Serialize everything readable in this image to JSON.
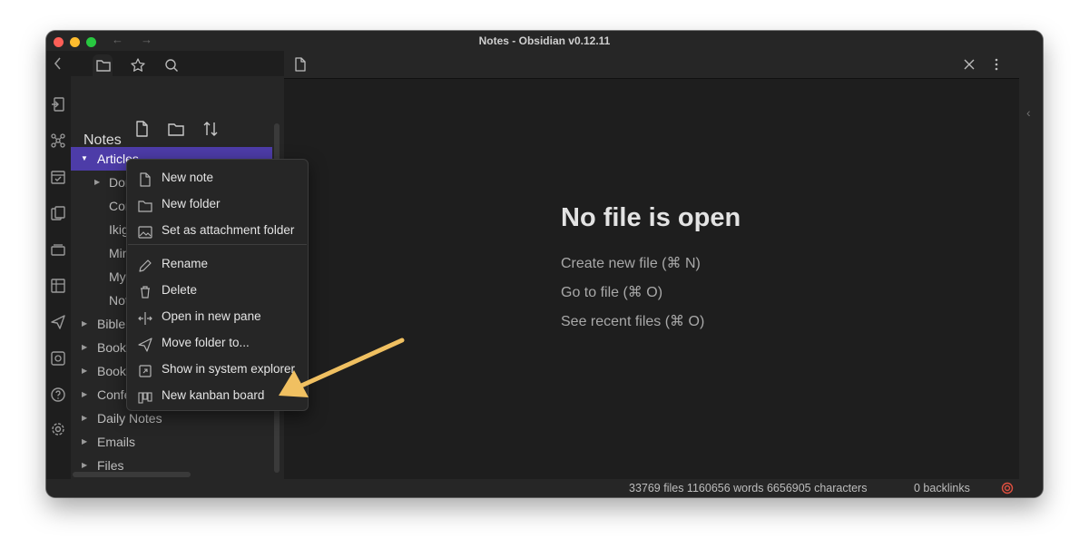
{
  "window": {
    "title": "Notes - Obsidian v0.12.11"
  },
  "sidebar": {
    "vault_name": "Notes",
    "tree": [
      {
        "label": "Articles",
        "expanded": true,
        "selected": true
      },
      {
        "label": "Dor",
        "has_children": true
      },
      {
        "label": "Cor"
      },
      {
        "label": "Ikig"
      },
      {
        "label": "Min"
      },
      {
        "label": "My"
      },
      {
        "label": "Not"
      },
      {
        "label": "Bible",
        "has_children": true
      },
      {
        "label": "Book",
        "has_children": true
      },
      {
        "label": "Book",
        "has_children": true
      },
      {
        "label": "Confe",
        "has_children": true
      },
      {
        "label": "Daily Notes",
        "has_children": true
      },
      {
        "label": "Emails",
        "has_children": true
      },
      {
        "label": "Files",
        "has_children": true
      }
    ]
  },
  "context_menu": {
    "items": [
      {
        "label": "New note",
        "icon": "new-note-icon"
      },
      {
        "label": "New folder",
        "icon": "folder-icon"
      },
      {
        "label": "Set as attachment folder",
        "icon": "image-icon"
      },
      {
        "label": "Rename",
        "icon": "pencil-icon"
      },
      {
        "label": "Delete",
        "icon": "trash-icon"
      },
      {
        "label": "Open in new pane",
        "icon": "split-icon"
      },
      {
        "label": "Move folder to...",
        "icon": "paper-plane-icon"
      },
      {
        "label": "Show in system explorer",
        "icon": "external-icon"
      },
      {
        "label": "New kanban board",
        "icon": "kanban-icon"
      }
    ]
  },
  "main": {
    "empty_title": "No file is open",
    "links": [
      "Create new file (⌘ N)",
      "Go to file (⌘ O)",
      "See recent files (⌘ O)"
    ]
  },
  "status": {
    "counts": "33769 files 1160656 words 6656905 characters",
    "backlinks": "0 backlinks"
  },
  "colors": {
    "accent": "#4d3ca8",
    "annotation_arrow": "#f0c061"
  }
}
